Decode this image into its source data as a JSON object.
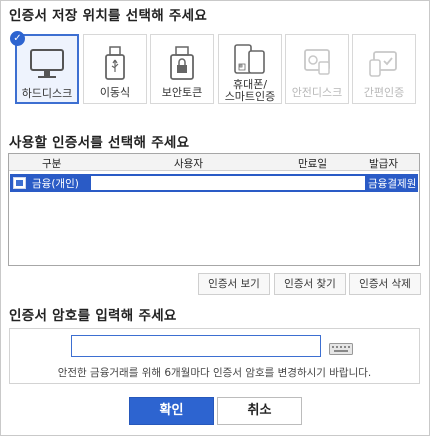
{
  "storage": {
    "title": "인증서 저장 위치를 선택해 주세요",
    "tiles": [
      {
        "label": "하드디스크",
        "icon": "monitor-icon",
        "selected": true,
        "disabled": false
      },
      {
        "label": "이동식",
        "icon": "usb-icon",
        "selected": false,
        "disabled": false
      },
      {
        "label": "보안토큰",
        "icon": "security-token-icon",
        "selected": false,
        "disabled": false
      },
      {
        "label": "휴대폰/",
        "label2": "스마트인증",
        "icon": "mobile-phone-icon",
        "selected": false,
        "disabled": false
      },
      {
        "label": "안전디스크",
        "icon": "safe-disk-icon",
        "selected": false,
        "disabled": true
      },
      {
        "label": "간편인증",
        "icon": "simple-auth-icon",
        "selected": false,
        "disabled": true
      }
    ]
  },
  "certs": {
    "title": "사용할 인증서를 선택해 주세요",
    "columns": [
      "구분",
      "사용자",
      "만료일",
      "발급자"
    ],
    "rows": [
      {
        "type": "금융(개인)",
        "user": "",
        "expiry": "",
        "issuer": "금융결제원"
      }
    ],
    "buttons": {
      "view": "인증서 보기",
      "find": "인증서 찾기",
      "delete": "인증서 삭제"
    }
  },
  "password": {
    "title": "인증서 암호를 입력해 주세요",
    "value": "",
    "notice": "안전한 금융거래를 위해 6개월마다 인증서 암호를 변경하시기 바랍니다."
  },
  "actions": {
    "ok": "확인",
    "cancel": "취소"
  },
  "colors": {
    "accent": "#2d64d0",
    "selected_row": "#2a5bc6"
  }
}
